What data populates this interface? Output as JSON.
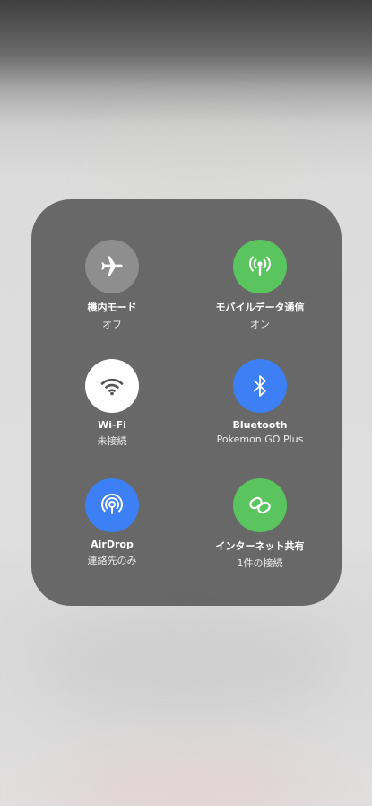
{
  "control_center": {
    "tiles": [
      {
        "label": "機内モード",
        "status": "オフ",
        "icon": "airplane-icon",
        "color": "#8e8e8e"
      },
      {
        "label": "モバイルデータ通信",
        "status": "オン",
        "icon": "cellular-antenna-icon",
        "color": "#5ac45e"
      },
      {
        "label": "Wi-Fi",
        "status": "未接続",
        "icon": "wifi-icon",
        "color": "#ffffff"
      },
      {
        "label": "Bluetooth",
        "status": "Pokemon GO Plus",
        "icon": "bluetooth-icon",
        "color": "#3d80f5"
      },
      {
        "label": "AirDrop",
        "status": "連絡先のみ",
        "icon": "airdrop-icon",
        "color": "#3d80f5"
      },
      {
        "label": "インターネット共有",
        "status": "1件の接続",
        "icon": "personal-hotspot-icon",
        "color": "#5ac45e"
      }
    ]
  }
}
